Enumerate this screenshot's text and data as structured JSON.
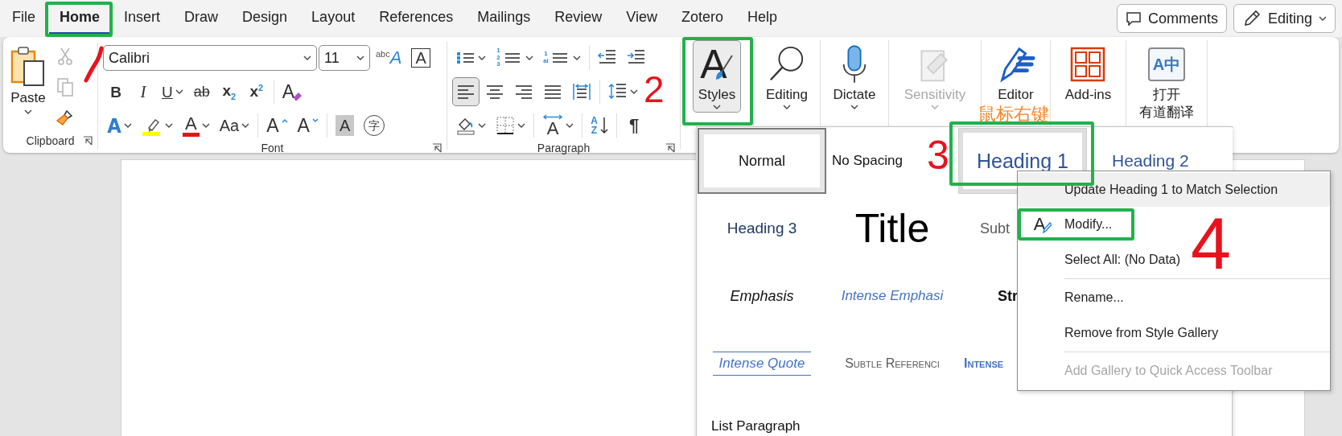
{
  "menu_tabs": [
    {
      "label": "File",
      "selected": false
    },
    {
      "label": "Home",
      "selected": true
    },
    {
      "label": "Insert",
      "selected": false
    },
    {
      "label": "Draw",
      "selected": false
    },
    {
      "label": "Design",
      "selected": false
    },
    {
      "label": "Layout",
      "selected": false
    },
    {
      "label": "References",
      "selected": false
    },
    {
      "label": "Mailings",
      "selected": false
    },
    {
      "label": "Review",
      "selected": false
    },
    {
      "label": "View",
      "selected": false
    },
    {
      "label": "Zotero",
      "selected": false
    },
    {
      "label": "Help",
      "selected": false
    }
  ],
  "top_buttons": [
    {
      "kind": "comments",
      "label": "Comments"
    },
    {
      "kind": "mode",
      "label": "Editing"
    }
  ],
  "clipboard": {
    "group_label": "Clipboard",
    "paste": "Paste",
    "tools": [
      {
        "kind": "cut",
        "disabled": true
      },
      {
        "kind": "copy",
        "disabled": true
      },
      {
        "kind": "format_painter",
        "disabled": false
      }
    ]
  },
  "font": {
    "group_label": "Font",
    "name": "Calibri",
    "size": "11",
    "top_tools": [
      {
        "kind": "abc",
        "glyph": "$^{abc}$A"
      },
      {
        "kind": "boxed",
        "glyph": "A"
      }
    ],
    "format_tools": [
      {
        "kind": "bold",
        "glyph": "B"
      },
      {
        "kind": "italic",
        "glyph": "I"
      },
      {
        "kind": "underline",
        "glyph": "U"
      },
      {
        "kind": "strike",
        "glyph": "ab"
      },
      {
        "kind": "sub",
        "glyph": "x$_{2}$"
      },
      {
        "kind": "sup",
        "glyph": "x$^{2}$"
      },
      {
        "kind": "clear",
        "glyph": "A"
      }
    ],
    "effect_tools": [
      {
        "kind": "effects",
        "glyph": "A"
      },
      {
        "kind": "highlight"
      },
      {
        "kind": "color",
        "glyph": "A"
      },
      {
        "kind": "case",
        "glyph": "Aa"
      },
      {
        "kind": "grow",
        "glyph": "A"
      },
      {
        "kind": "shrink",
        "glyph": "A"
      },
      {
        "kind": "shade",
        "glyph": "A"
      },
      {
        "kind": "phonetic",
        "glyph": "字"
      }
    ]
  },
  "paragraph": {
    "group_label": "Paragraph",
    "lists": [
      {
        "kind": "bullets"
      },
      {
        "kind": "numbering",
        "glyph": "123"
      },
      {
        "kind": "multilevel",
        "glyph": "1ai"
      },
      {
        "kind": "outdent"
      },
      {
        "kind": "indent"
      }
    ],
    "alignments": [
      {
        "kind": "left",
        "selected": true
      },
      {
        "kind": "center",
        "selected": false
      },
      {
        "kind": "right",
        "selected": false
      },
      {
        "kind": "justify",
        "selected": false
      },
      {
        "kind": "distributed",
        "selected": false
      }
    ],
    "tools": [
      {
        "kind": "shading"
      },
      {
        "kind": "borders"
      },
      {
        "kind": "asian",
        "glyph": "A"
      },
      {
        "kind": "sort",
        "glyph": "AZ"
      },
      {
        "kind": "pilcrow",
        "glyph": "¶"
      }
    ]
  },
  "commands": [
    {
      "kind": "styles",
      "label": "Styles",
      "glyph": "A",
      "pressed": true,
      "disabled": false
    },
    {
      "kind": "find",
      "label": "Editing",
      "pressed": false,
      "disabled": false
    },
    {
      "kind": "dictate",
      "label": "Dictate",
      "pressed": false,
      "disabled": false
    },
    {
      "kind": "sensitivity",
      "label": "Sensitivity",
      "pressed": false,
      "disabled": true
    },
    {
      "kind": "editor",
      "label": "Editor",
      "pressed": false,
      "disabled": false
    },
    {
      "kind": "addins",
      "label": "Add-ins",
      "pressed": false,
      "disabled": false
    },
    {
      "kind": "translate",
      "label": "打开",
      "label_2": "有道翻译",
      "glyph": "A中",
      "pressed": false,
      "disabled": false
    }
  ],
  "style_gallery": {
    "rows": [
      {
        "styles": [
          {
            "kind": "normal",
            "label": "Normal",
            "selected": true,
            "hovered": false
          },
          {
            "kind": "plain",
            "label": "No Spacing",
            "selected": false,
            "hovered": false
          },
          {
            "kind": "heading1",
            "label": "Heading 1",
            "selected": false,
            "hovered": true
          },
          {
            "kind": "heading2",
            "label": "Heading 2",
            "selected": false,
            "hovered": false
          }
        ]
      },
      {
        "styles": [
          {
            "kind": "heading3",
            "label": "Heading 3",
            "selected": false,
            "hovered": false
          },
          {
            "kind": "title",
            "label": "Title",
            "selected": false,
            "hovered": false
          },
          {
            "kind": "subtitle",
            "label": "Subt",
            "selected": false,
            "hovered": false
          }
        ]
      },
      {
        "styles": [
          {
            "kind": "emphasis",
            "label": "Emphasis",
            "selected": false,
            "hovered": false
          },
          {
            "kind": "intense_emphasis",
            "label": "Intense Emphasi",
            "selected": false,
            "hovered": false
          },
          {
            "kind": "strong",
            "label": "Str",
            "selected": false,
            "hovered": false
          }
        ]
      },
      {
        "styles": [
          {
            "kind": "intense_quote",
            "label": "Intense Quote",
            "selected": false,
            "hovered": false
          },
          {
            "kind": "subtle_reference",
            "label": "Subtle Referenci",
            "selected": false,
            "hovered": false
          },
          {
            "kind": "intense_reference",
            "label": "Intense",
            "selected": false,
            "hovered": false
          }
        ]
      },
      {
        "styles": [
          {
            "kind": "list",
            "label": "List Paragraph",
            "selected": false,
            "hovered": false
          }
        ]
      }
    ]
  },
  "context_menu": {
    "sections": [
      {
        "items": [
          {
            "label": "Update Heading 1 to Match Selection",
            "kind": "plain",
            "hovered": true,
            "disabled": false,
            "circled": false
          },
          {
            "label": "Modify...",
            "kind": "icon",
            "glyph": "A",
            "hovered": false,
            "disabled": false,
            "circled": true
          },
          {
            "label": "Select All: (No Data)",
            "kind": "plain",
            "hovered": false,
            "disabled": false,
            "circled": false
          }
        ]
      },
      {
        "items": [
          {
            "label": "Rename...",
            "kind": "plain",
            "hovered": false,
            "disabled": false,
            "circled": false
          },
          {
            "label": "Remove from Style Gallery",
            "kind": "plain",
            "hovered": false,
            "disabled": false,
            "circled": false
          }
        ]
      },
      {
        "items": [
          {
            "label": "Add Gallery to Quick Access Toolbar",
            "kind": "plain",
            "hovered": false,
            "disabled": true,
            "circled": false
          }
        ]
      }
    ]
  },
  "annotations": [
    {
      "kind": "number",
      "text": "2"
    },
    {
      "kind": "number",
      "text": "3"
    },
    {
      "kind": "note",
      "text": "鼠标右键"
    },
    {
      "kind": "number",
      "text": "4"
    }
  ]
}
